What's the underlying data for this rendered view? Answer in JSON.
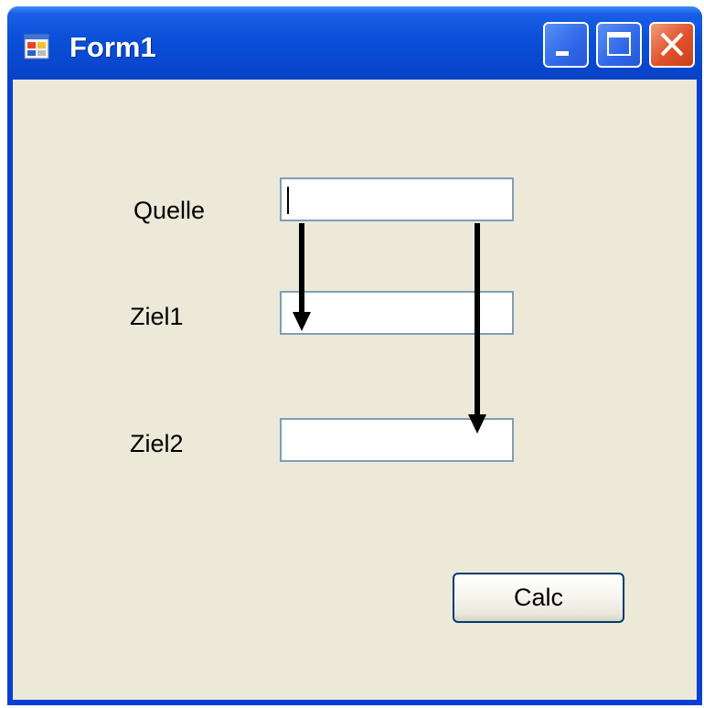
{
  "window": {
    "title": "Form1",
    "icon": "form-app-icon",
    "buttons": {
      "minimize": "minimize-icon",
      "maximize": "maximize-icon",
      "close": "close-icon"
    }
  },
  "form": {
    "quelle_label": "Quelle",
    "ziel1_label": "Ziel1",
    "ziel2_label": "Ziel2",
    "quelle_value": "",
    "ziel1_value": "",
    "ziel2_value": "",
    "calc_label": "Calc"
  },
  "colors": {
    "titlebar": "#0a48d0",
    "client_background": "#ece9d8",
    "textbox_border": "#7f9db9",
    "close_button": "#e0512a"
  }
}
